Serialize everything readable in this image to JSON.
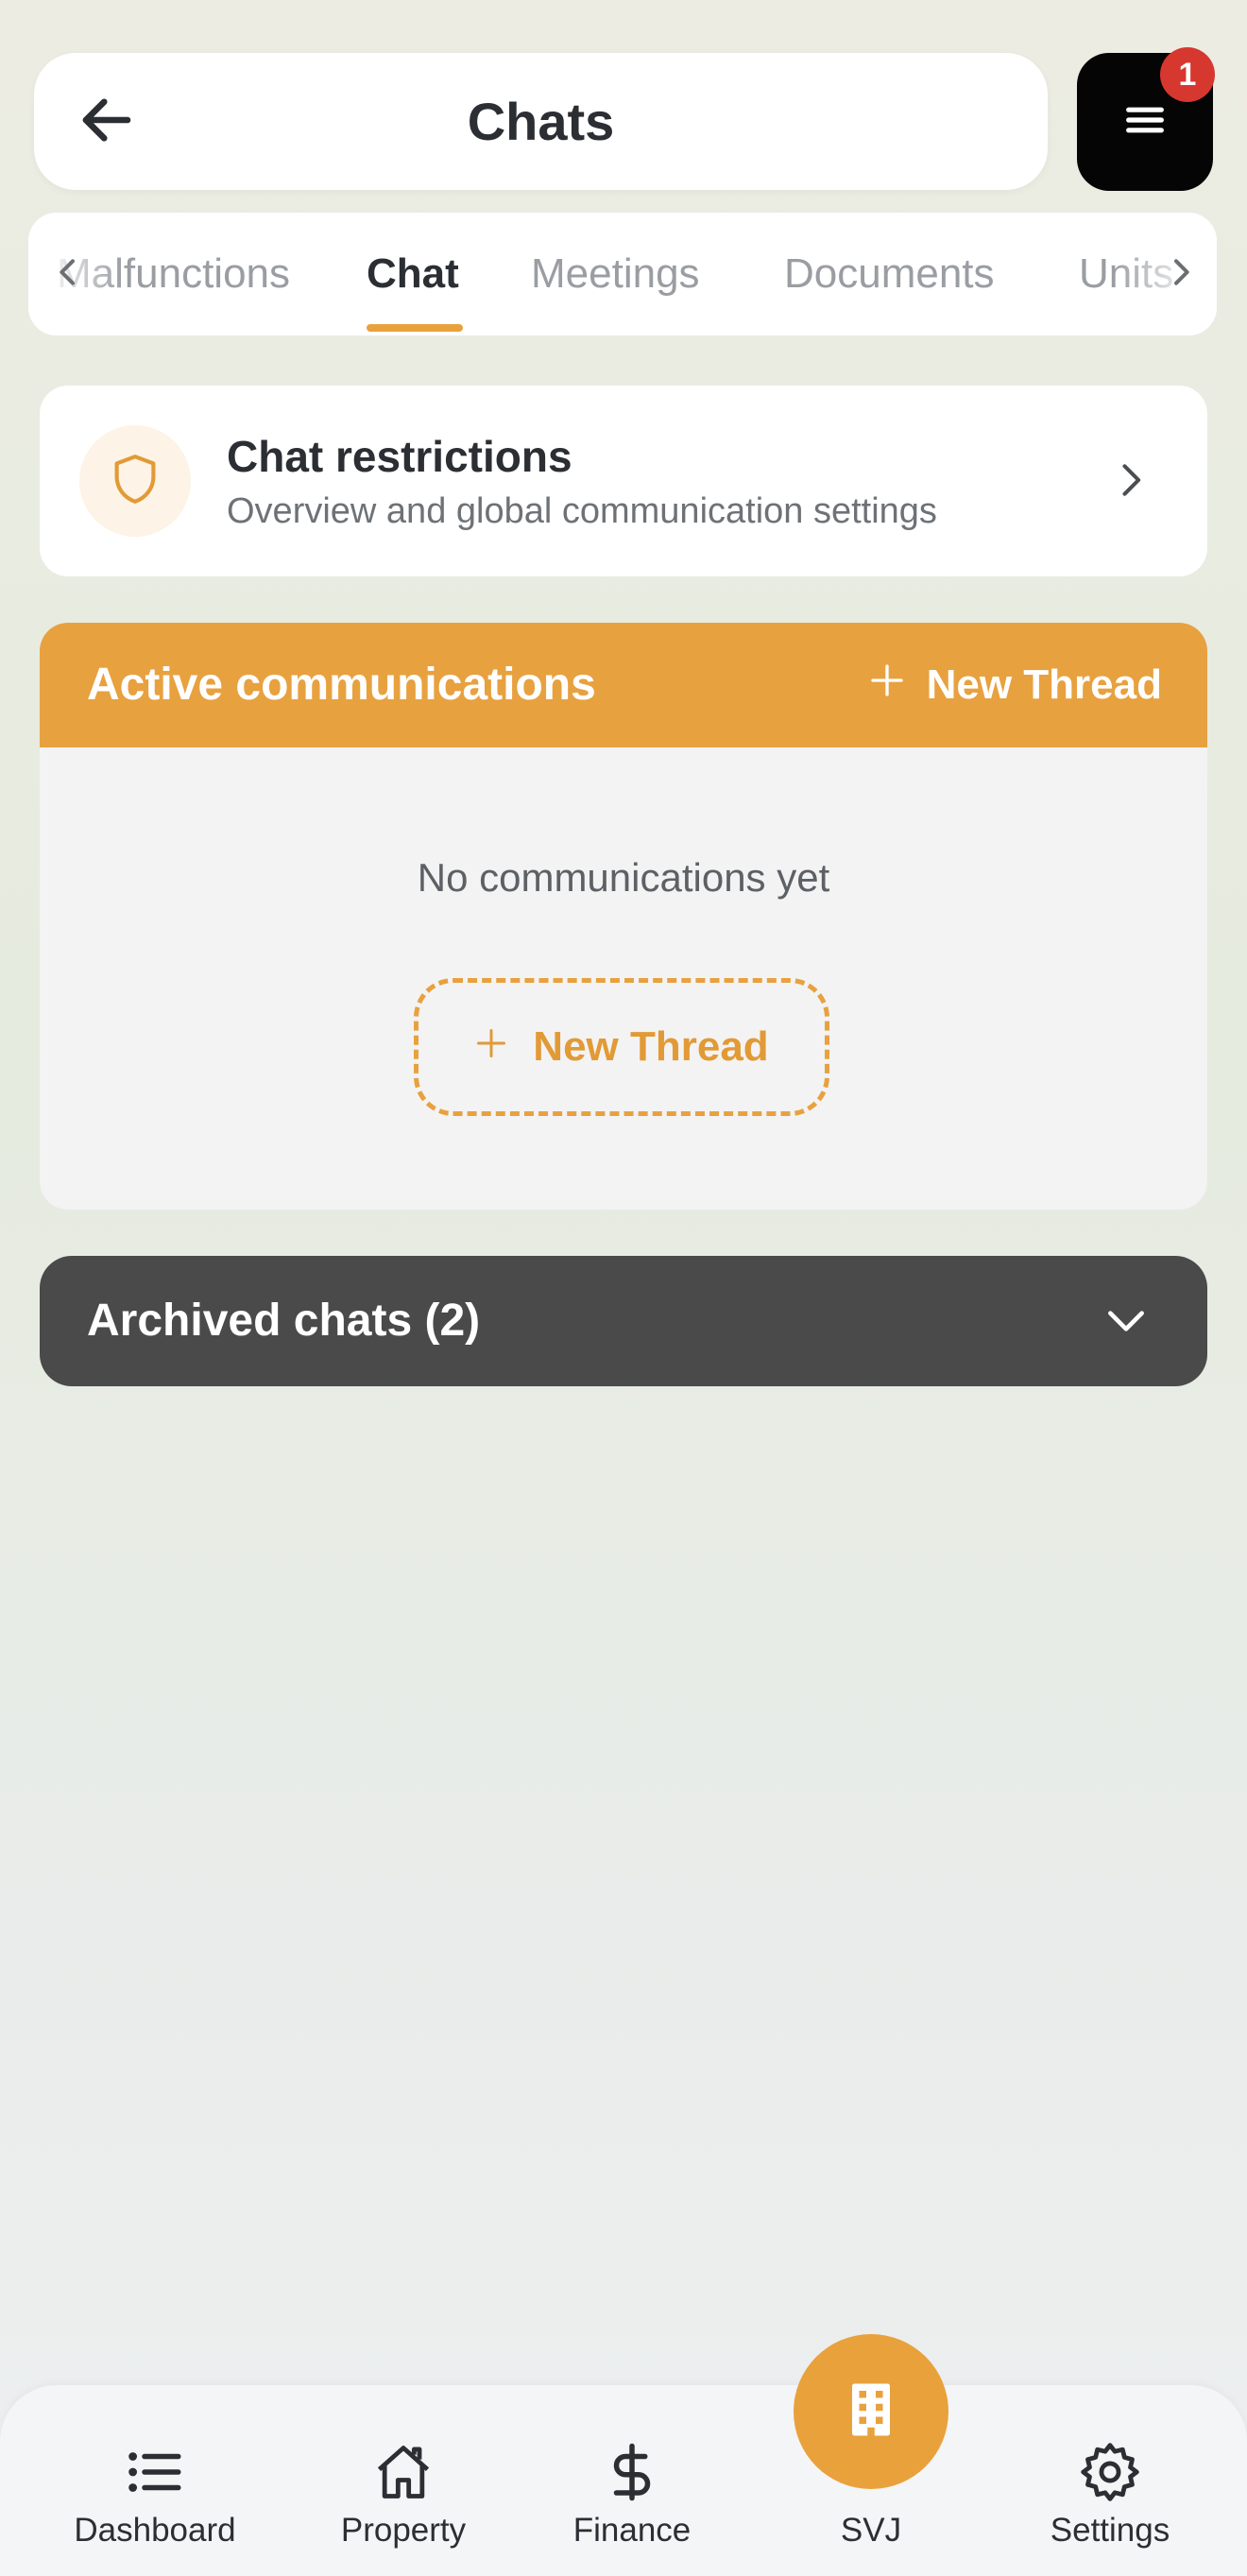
{
  "header": {
    "title": "Chats",
    "back_icon": "arrow-left-icon",
    "menu_icon": "hamburger-menu-icon",
    "menu_badge": "1"
  },
  "tabs": {
    "items": [
      {
        "label": "Malfunctions",
        "active": false
      },
      {
        "label": "Chat",
        "active": true
      },
      {
        "label": "Meetings",
        "active": false
      },
      {
        "label": "Documents",
        "active": false
      },
      {
        "label": "Units",
        "active": false
      }
    ],
    "left_arrow_icon": "chevron-left-icon",
    "right_arrow_icon": "chevron-right-icon"
  },
  "restrictions": {
    "title": "Chat restrictions",
    "subtitle": "Overview and global communication settings",
    "icon": "shield-icon"
  },
  "active_communications": {
    "title": "Active communications",
    "new_thread_label": "New Thread",
    "empty_text": "No communications yet",
    "empty_button_label": "New Thread"
  },
  "archived": {
    "title": "Archived chats (2)"
  },
  "bottom_nav": {
    "items": [
      {
        "label": "Dashboard",
        "icon": "list-icon"
      },
      {
        "label": "Property",
        "icon": "house-icon"
      },
      {
        "label": "Finance",
        "icon": "dollar-icon"
      },
      {
        "label": "SVJ",
        "icon": "building-icon"
      },
      {
        "label": "Settings",
        "icon": "gear-icon"
      }
    ]
  },
  "colors": {
    "accent": "#e9a13c",
    "dark": "#4a4a4a",
    "badge": "#d6372f"
  }
}
